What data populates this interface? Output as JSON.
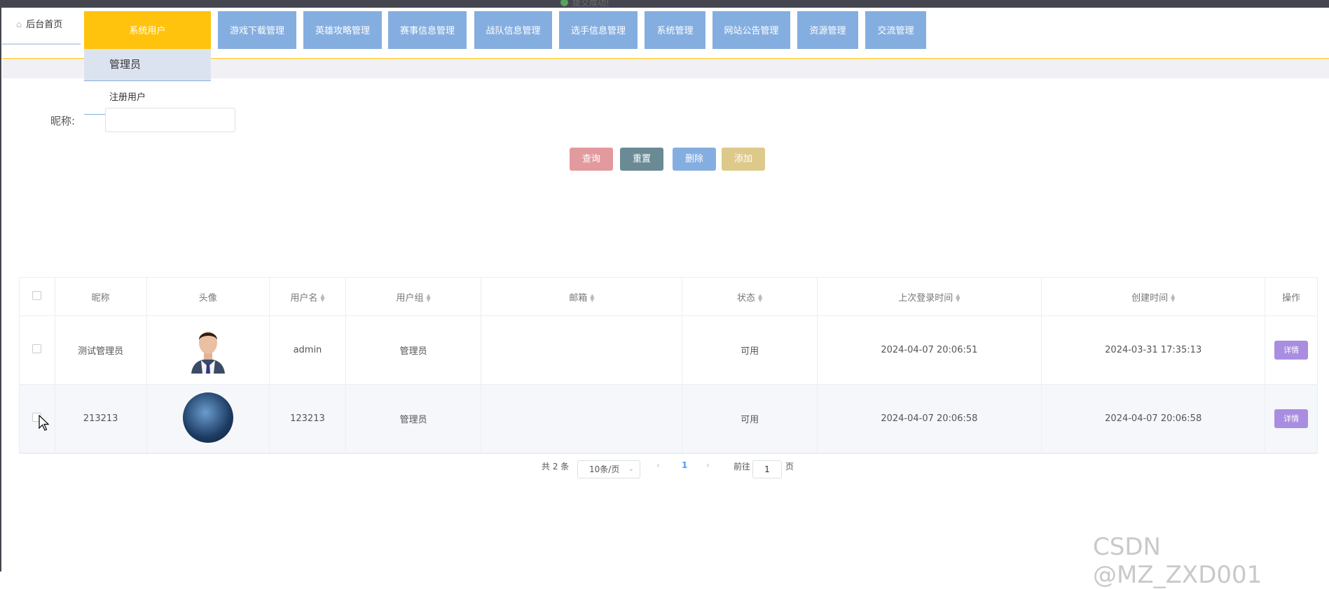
{
  "top_toast": "提交成功!",
  "home_tab": {
    "label": "后台首页",
    "icon": "home-icon"
  },
  "nav": [
    {
      "label": "系统用户",
      "active": true
    },
    {
      "label": "游戏下载管理"
    },
    {
      "label": "英雄攻略管理"
    },
    {
      "label": "赛事信息管理"
    },
    {
      "label": "战队信息管理"
    },
    {
      "label": "选手信息管理"
    },
    {
      "label": "系统管理"
    },
    {
      "label": "网站公告管理"
    },
    {
      "label": "资源管理"
    },
    {
      "label": "交流管理"
    }
  ],
  "dropdown": [
    "管理员",
    "注册用户"
  ],
  "search": {
    "label": "昵称:",
    "value": ""
  },
  "buttons": {
    "query": "查询",
    "reset": "重置",
    "delete": "删除",
    "add": "添加"
  },
  "colors": {
    "nav": "#85aee0",
    "nav_active": "#ffc30e",
    "query": "#e29a9f",
    "reset": "#6a8a95",
    "delete": "#85aee0",
    "add": "#ddc98a",
    "detail": "#a98de0"
  },
  "table": {
    "headers": [
      "昵称",
      "头像",
      "用户名",
      "用户组",
      "邮箱",
      "状态",
      "上次登录时间",
      "创建时间",
      "操作"
    ],
    "rows": [
      {
        "nickname": "测试管理员",
        "username": "admin",
        "group": "管理员",
        "email": "",
        "status": "可用",
        "last_login": "2024-04-07 20:06:51",
        "created": "2024-03-31 17:35:13",
        "action": "详情"
      },
      {
        "nickname": "213213",
        "username": "123213",
        "group": "管理员",
        "email": "",
        "status": "可用",
        "last_login": "2024-04-07 20:06:58",
        "created": "2024-04-07 20:06:58",
        "action": "详情"
      }
    ]
  },
  "pagination": {
    "total": "共 2 条",
    "page_size": "10条/页",
    "current": "1",
    "goto_prefix": "前往",
    "goto_value": "1",
    "goto_suffix": "页"
  },
  "watermark": "CSDN @MZ_ZXD001"
}
